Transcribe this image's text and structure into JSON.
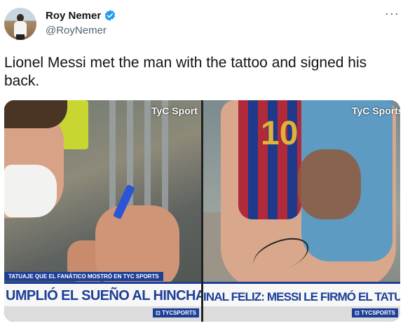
{
  "tweet": {
    "display_name": "Roy Nemer",
    "handle": "@RoyNemer",
    "text": "Lionel Messi met the man with the tattoo and signed his back.",
    "more_label": "···"
  },
  "media": {
    "left": {
      "logo": "TyC Sport",
      "kicker": "TATUAJE QUE EL FANÁTICO MOSTRÓ EN TYC SPORTS",
      "headline": "UMPLIÓ EL SUEÑO AL HINCHA B",
      "badge": "⊡ TYCSPORTS"
    },
    "right": {
      "logo": "TyC Sports",
      "jersey_number": "10",
      "headline": "INAL FELIZ: MESSI LE FIRMÓ EL TATUAJE AL HINC",
      "badge": "⊡ TYCSPORTS"
    }
  },
  "colors": {
    "verified": "#1d9bf0",
    "tv_blue": "#1d3f96",
    "secondary_text": "#536471"
  },
  "icons": [
    "verified-badge-icon",
    "more-options-icon"
  ]
}
